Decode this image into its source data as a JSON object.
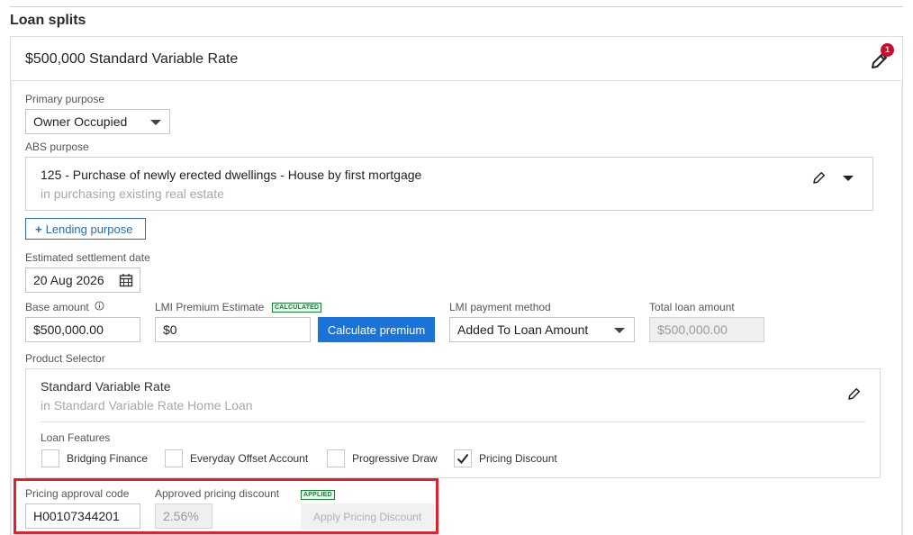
{
  "section_title": "Loan splits",
  "split": {
    "title": "$500,000 Standard Variable Rate",
    "edit_badge_count": "1"
  },
  "primary_purpose": {
    "label": "Primary purpose",
    "value": "Owner Occupied"
  },
  "abs_purpose": {
    "label": "ABS purpose",
    "main": "125 - Purchase of newly erected dwellings - House by first mortgage",
    "sub": "in purchasing existing real estate"
  },
  "lending_purpose_button": "Lending purpose",
  "settlement": {
    "label": "Estimated settlement date",
    "value": "20 Aug 2026"
  },
  "base_amount": {
    "label": "Base amount",
    "value": "$500,000.00"
  },
  "lmi_premium": {
    "label": "LMI Premium Estimate",
    "tag": "CALCULATED",
    "value": "$0"
  },
  "calculate_button": "Calculate premium",
  "lmi_method": {
    "label": "LMI payment method",
    "value": "Added To Loan Amount"
  },
  "total_loan": {
    "label": "Total loan amount",
    "value": "$500,000.00"
  },
  "product_selector": {
    "label": "Product Selector",
    "title": "Standard Variable Rate",
    "sub": "in Standard Variable Rate Home Loan",
    "features_label": "Loan Features",
    "features": [
      {
        "label": "Bridging Finance",
        "checked": false
      },
      {
        "label": "Everyday Offset Account",
        "checked": false
      },
      {
        "label": "Progressive Draw",
        "checked": false
      },
      {
        "label": "Pricing Discount",
        "checked": true
      }
    ]
  },
  "pricing": {
    "code_label": "Pricing approval code",
    "code_value": "H00107344201",
    "discount_label": "Approved pricing discount",
    "discount_value": "2.56%",
    "applied_tag": "APPLIED",
    "apply_button": "Apply Pricing Discount"
  },
  "colors": {
    "accent": "#1a73d9",
    "outline_button": "#2a6db5",
    "badge": "#c8102e",
    "highlight": "#e0202a",
    "tag_green": "#1f7a3a"
  }
}
